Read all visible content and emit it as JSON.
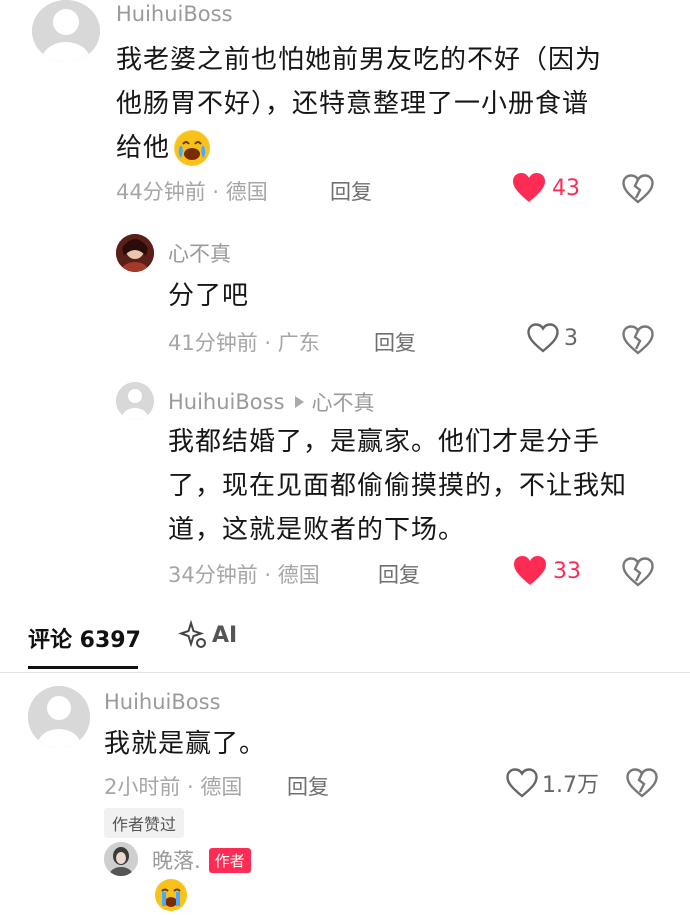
{
  "thread": {
    "top_comment": {
      "username": "HuihuiBoss",
      "text": "我老婆之前也怕她前男友吃的不好（因为他肠胃不好），还特意整理了一小册食谱给他",
      "line1": "我老婆之前也怕她前男友吃的不好（因为",
      "line2": "他肠胃不好），还特意整理了一小册食谱",
      "line3": "给他",
      "time": "44分钟前 · 德国",
      "reply_label": "回复",
      "likes": "43",
      "liked": true
    },
    "reply1": {
      "username": "心不真",
      "text": "分了吧",
      "time": "41分钟前 · 广东",
      "reply_label": "回复",
      "likes": "3",
      "liked": false
    },
    "reply2": {
      "username": "HuihuiBoss",
      "reply_to": "心不真",
      "line1": "我都结婚了，是赢家。他们才是分手",
      "line2": "了，现在见面都偷偷摸摸的，不让我知",
      "line3": "道，这就是败者的下场。",
      "time": "34分钟前 · 德国",
      "reply_label": "回复",
      "likes": "33",
      "liked": true
    }
  },
  "tabs": {
    "comments_label": "评论 6397",
    "ai_label": "AI"
  },
  "comment2": {
    "username": "HuihuiBoss",
    "text": "我就是赢了。",
    "time": "2小时前 · 德国",
    "reply_label": "回复",
    "likes": "1.7万",
    "liked": false,
    "author_liked_badge": "作者赞过",
    "sub_reply": {
      "username": "晚落.",
      "author_badge": "作者"
    }
  },
  "colors": {
    "like_red": "#fe2c55",
    "meta_gray": "#a6a6a6",
    "username_gray": "#9a9a9a"
  }
}
